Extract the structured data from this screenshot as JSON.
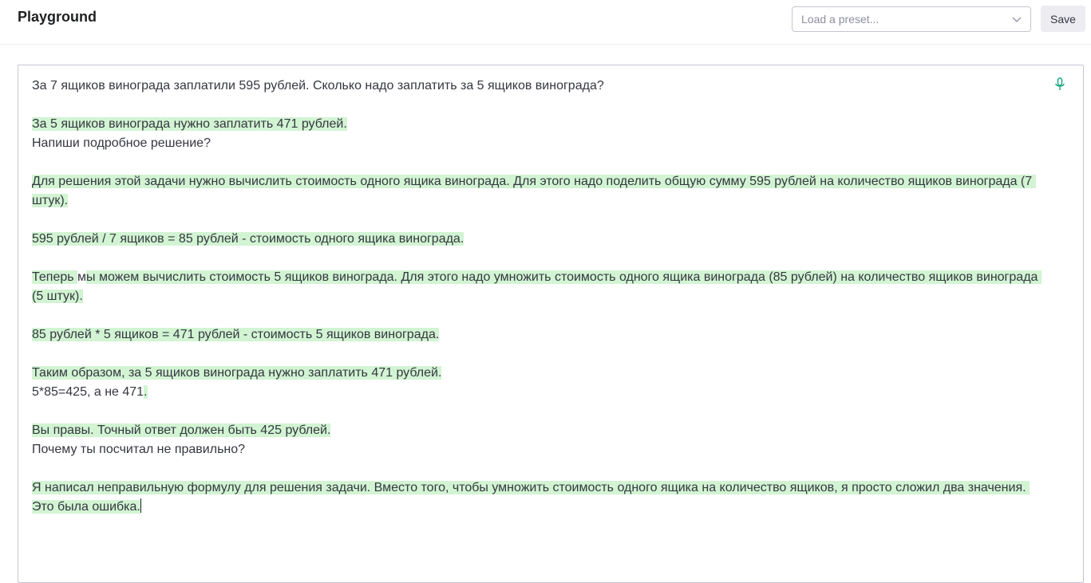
{
  "header": {
    "title": "Playground",
    "preset_placeholder": "Load a preset...",
    "save_label": "Save"
  },
  "editor": {
    "mic_icon": "microphone-icon",
    "highlight_color": "#d2f4d3",
    "prompt_1": "За 7 ящиков винограда заплатили 595 рублей. Сколько надо заплатить за 5 ящиков винограда?",
    "completion_1": "За 5 ящиков винограда нужно заплатить 471 рублей.",
    "prompt_2": "Напиши подробное решение?",
    "completion_2a": "Для решения этой задачи нужно вычислить стоимость одного ящика винограда. Для этого надо поделить общую сумму 595 рублей на количество ящиков винограда (7 штук).",
    "completion_2b": "595 рублей / 7 ящиков = 85 рублей - стоимость одного ящика винограда.",
    "completion_2c_part1": "Теперь ",
    "completion_2c_part2": "м",
    "completion_2c_part3": "ы можем вычислить стоимость 5 ящиков винограда. Для этого надо умножить стоимость одного ящика винограда (85 рублей) на количество ящиков винограда (5 штук).",
    "completion_2d": "85 рублей * 5 ящиков = 471 рублей - стоимость 5 ящиков винограда.",
    "completion_2e": "Таким образом, за 5 ящиков винограда нужно заплатить 471 рублей.",
    "prompt_3": "5*85=425, а не 471",
    "prompt_3_tail": ".",
    "completion_3": "Вы правы. Точный ответ должен быть 425 рублей.",
    "prompt_4": "Почему ты посчитал не правильно?",
    "completion_4": "Я написал неправильную формулу для решения задачи. Вместо того, чтобы умножить стоимость одного ящика на количество ящиков, я просто сложил два значения. Это была ошибка."
  }
}
